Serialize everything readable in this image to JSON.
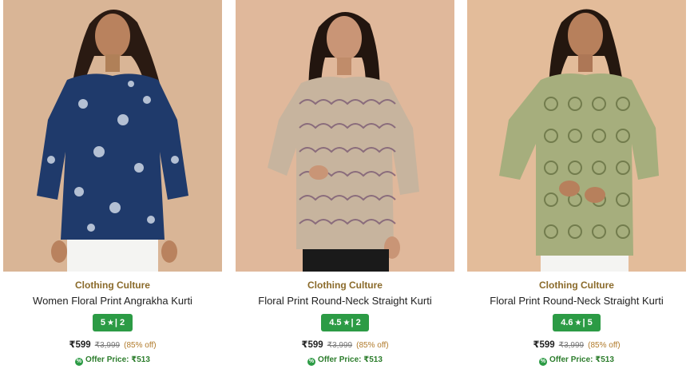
{
  "products": [
    {
      "brand": "Clothing Culture",
      "title": "Women Floral Print Angrakha Kurti",
      "rating": "5",
      "reviews": "2",
      "price": "₹599",
      "mrp": "₹3,999",
      "discount": "(85% off)",
      "offer_label": "Offer Price: ₹513",
      "colors": {
        "background": "#d9b596",
        "garment": "#1f3a6b",
        "pattern": "#cfd8e6",
        "pants": "#f4f4f2"
      }
    },
    {
      "brand": "Clothing Culture",
      "title": "Floral Print Round-Neck Straight Kurti",
      "rating": "4.5",
      "reviews": "2",
      "price": "₹599",
      "mrp": "₹3,999",
      "discount": "(85% off)",
      "offer_label": "Offer Price: ₹513",
      "colors": {
        "background": "#e0b89b",
        "garment": "#c7b49e",
        "pattern": "#7b5b74",
        "pants": "#1a1a1a"
      }
    },
    {
      "brand": "Clothing Culture",
      "title": "Floral Print Round-Neck Straight Kurti",
      "rating": "4.6",
      "reviews": "5",
      "price": "₹599",
      "mrp": "₹3,999",
      "discount": "(85% off)",
      "offer_label": "Offer Price: ₹513",
      "colors": {
        "background": "#e3bc9a",
        "garment": "#a6ae7d",
        "pattern": "#6a7445",
        "pants": "#f4f4f2"
      }
    }
  ],
  "icons": {
    "star": "★",
    "offer": "%"
  }
}
